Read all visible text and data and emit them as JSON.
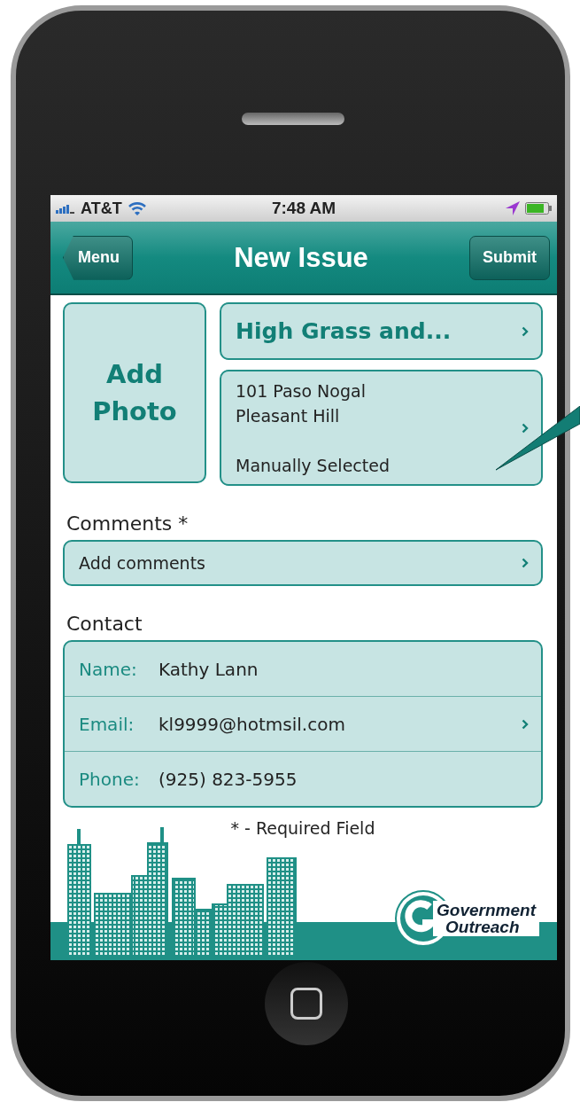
{
  "status_bar": {
    "carrier": "AT&T",
    "time": "7:48 AM"
  },
  "nav_bar": {
    "back_button": "Menu",
    "title": "New Issue",
    "action_button": "Submit"
  },
  "photo_button": {
    "label": "Add Photo"
  },
  "category": {
    "value": "High Grass and..."
  },
  "location": {
    "lines": [
      "101 Paso Nogal",
      "Pleasant Hill"
    ],
    "note": "Manually Selected"
  },
  "comments": {
    "label": "Comments *",
    "placeholder": "Add comments"
  },
  "contact": {
    "label": "Contact",
    "rows": [
      {
        "label": "Name:",
        "value": "Kathy Lann",
        "disclosure": false
      },
      {
        "label": "Email:",
        "value": "kl9999@hotmsil.com",
        "disclosure": true
      },
      {
        "label": "Phone:",
        "value": "(925) 823-5955",
        "disclosure": false
      }
    ]
  },
  "footnote": "* - Required Field",
  "logo": {
    "lines": [
      "Government",
      "Outreach"
    ]
  }
}
